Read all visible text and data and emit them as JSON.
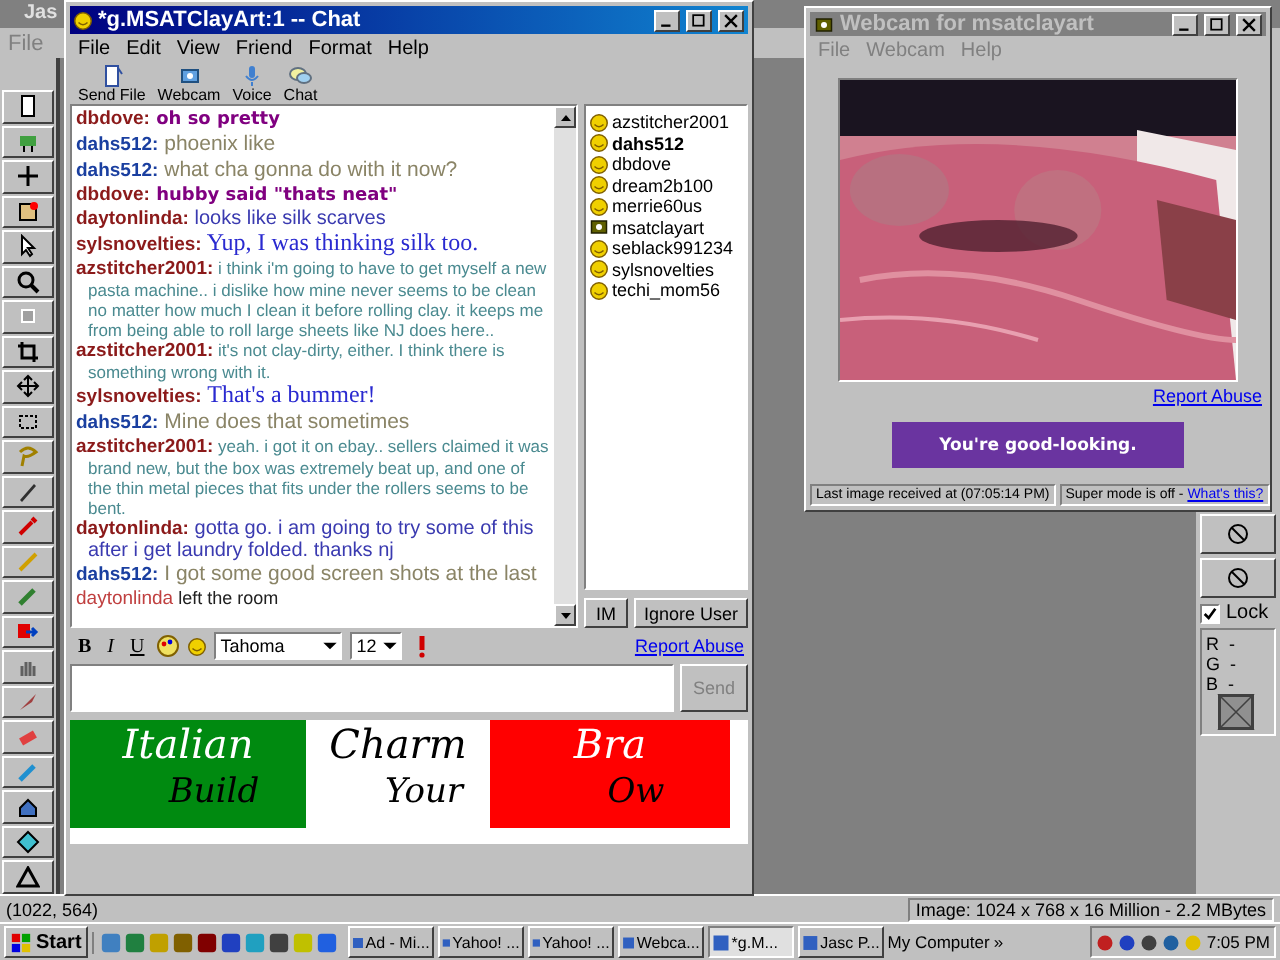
{
  "app": {
    "title": "Jas",
    "menu": [
      "File"
    ]
  },
  "chat_window": {
    "title": "*g.MSATClayArt:1 -- Chat",
    "menu": [
      "File",
      "Edit",
      "View",
      "Friend",
      "Format",
      "Help"
    ],
    "toolbar": [
      {
        "label": "Send File",
        "kind": "file"
      },
      {
        "label": "Webcam",
        "kind": "webcam"
      },
      {
        "label": "Voice",
        "kind": "voice"
      },
      {
        "label": "Chat",
        "kind": "chat"
      }
    ],
    "messages": [
      {
        "name": "dbdove:",
        "text": "oh so pretty",
        "kind": "bold"
      },
      {
        "name": "dahs512:",
        "text": "phoenix like",
        "kind": "grey"
      },
      {
        "name": "dahs512:",
        "text": "what cha gonna do with it now?",
        "kind": "grey"
      },
      {
        "name": "dbdove:",
        "text": "hubby said \"thats neat\"",
        "kind": "bold"
      },
      {
        "name": "daytonlinda:",
        "text": "looks like silk scarves",
        "kind": "sans"
      },
      {
        "name": "sylsnovelties:",
        "text": "Yup, I was thinking silk too.",
        "kind": "serif"
      },
      {
        "name": "azstitcher2001:",
        "text": "i think i'm going to have to get myself a new pasta machine.. i dislike how mine never seems to be clean no matter how much I clean it before rolling clay. it keeps me from being able to roll large sheets like NJ does here..",
        "kind": "comic"
      },
      {
        "name": "azstitcher2001:",
        "text": "it's not clay-dirty, either. I think there is something wrong with it.",
        "kind": "comic"
      },
      {
        "name": "sylsnovelties:",
        "text": "That's a bummer!",
        "kind": "serif"
      },
      {
        "name": "dahs512:",
        "text": "Mine does that sometimes",
        "kind": "grey"
      },
      {
        "name": "azstitcher2001:",
        "text": "yeah. i got it on ebay.. sellers claimed it was brand new, but the box was extremely beat up, and one of the thin metal pieces that fits under the rollers seems to be bent.",
        "kind": "comic"
      },
      {
        "name": "daytonlinda:",
        "text": "gotta go. i am going to try some of this after i get laundry folded. thanks nj",
        "kind": "sans"
      },
      {
        "name": "dahs512:",
        "text": "I got some good screen shots at the last",
        "kind": "grey"
      },
      {
        "name": "daytonlinda",
        "text": "left the room",
        "kind": "event"
      }
    ],
    "users": [
      {
        "name": "azstitcher2001",
        "kind": "smiley",
        "bold": false
      },
      {
        "name": "dahs512",
        "kind": "smiley",
        "bold": true
      },
      {
        "name": "dbdove",
        "kind": "smiley",
        "bold": false
      },
      {
        "name": "dream2b100",
        "kind": "smiley",
        "bold": false
      },
      {
        "name": "merrie60us",
        "kind": "smiley",
        "bold": false
      },
      {
        "name": "msatclayart",
        "kind": "webcam",
        "bold": false
      },
      {
        "name": "seblack991234",
        "kind": "smiley",
        "bold": false
      },
      {
        "name": "sylsnovelties",
        "kind": "smiley",
        "bold": false
      },
      {
        "name": "techi_mom56",
        "kind": "smiley",
        "bold": false
      }
    ],
    "user_buttons": [
      "IM",
      "Ignore User"
    ],
    "format_bar": {
      "buttons": [
        "B",
        "I",
        "U"
      ],
      "font": "Tahoma",
      "size": "12",
      "report_link": "Report Abuse"
    },
    "send_button": {
      "label": "Send",
      "disabled": true
    },
    "banner": [
      {
        "top": "Italian",
        "bottom": "Build",
        "color": "#008a10"
      },
      {
        "top": "Charm",
        "bottom": "Your",
        "color": "#ffffff"
      },
      {
        "top": "Bra",
        "bottom": "Ow",
        "color": "#ff0000"
      }
    ]
  },
  "webcam_window": {
    "title": "Webcam for msatclayart",
    "menu": [
      "File",
      "Webcam",
      "Help"
    ],
    "report_link": "Report Abuse",
    "ad": "You're good-looking.",
    "status": "Last image received at (07:05:14 PM)",
    "mode": "Super mode is off - ",
    "mode_link": "What's this?"
  },
  "tool_options": {
    "lock": {
      "label": "Lock",
      "checked": true
    },
    "readout": [
      "R  -",
      "G  -",
      "B  -"
    ]
  },
  "status_bar": {
    "position": "(1022, 564)",
    "image_info": "Image:  1024 x 768 x 16 Million - 2.2 MBytes"
  },
  "taskbar": {
    "start": "Start",
    "tasks": [
      {
        "label": "Ad - Mi...",
        "selected": false
      },
      {
        "label": "Yahoo! ...",
        "selected": false
      },
      {
        "label": "Yahoo! ...",
        "selected": false
      },
      {
        "label": "Webca...",
        "selected": false
      },
      {
        "label": "*g.M...",
        "selected": true
      },
      {
        "label": "Jasc P...",
        "selected": false
      }
    ],
    "address": "My Computer",
    "chevron": "»",
    "clock": "7:05 PM"
  }
}
